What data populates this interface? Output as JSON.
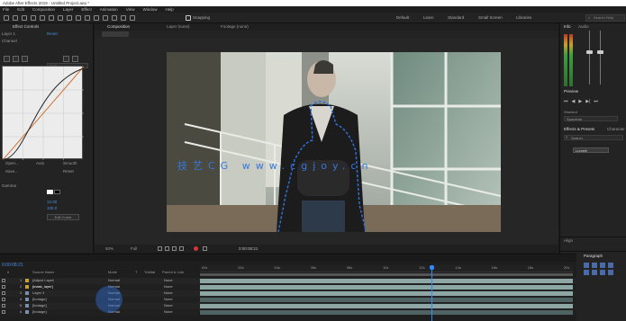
{
  "title_bar": {
    "text": "Adobe After Effects 2019 - Untitled Project.aep *"
  },
  "menu": [
    "File",
    "Edit",
    "Composition",
    "Layer",
    "Effect",
    "Animation",
    "View",
    "Window",
    "Help"
  ],
  "toolbar": {
    "snapping_label": "Snapping",
    "workspaces": [
      "Default",
      "Learn",
      "Standard",
      "Small Screen",
      "Libraries"
    ],
    "active_workspace": "",
    "search_placeholder": "Search Help"
  },
  "left_panel": {
    "tab_label": "Effect Controls",
    "layer_label": "Layer 1",
    "channel_label": "Channel",
    "channel_value": "RGB",
    "curve_buttons": [
      "Open...",
      "Auto",
      "Smooth",
      "Save...",
      "Reset"
    ],
    "gamma_label": "Gamma",
    "gamma_value": "",
    "values": [
      "12.00",
      "100.0"
    ],
    "edit_button": "Edit Curve"
  },
  "viewer": {
    "comp_tab": "Composition",
    "layer_tab": "Layer (none)",
    "footage_tab": "Footage (none)",
    "watermark": "技艺CG www.cgjoy.cn",
    "zoom": "50%",
    "quality": "Full",
    "timecode": "0:00:08:21"
  },
  "right_panel": {
    "info_tab": "Info",
    "audio_tab": "Audio",
    "preview_tab": "Preview",
    "shortcut_label": "Shortcut",
    "shortcut_value": "Spacebar",
    "effects_tab": "Effects & Presets",
    "chars_tab": "Character",
    "search_text": "Search",
    "library_item": "Lumetri",
    "bottom_tab": "Align",
    "paragraph_tab": "Paragraph"
  },
  "timeline": {
    "timecode": "0:00:08:21",
    "columns": [
      "#",
      "Source Name",
      "Mode",
      "T",
      "TrkMat",
      "Parent & Link"
    ],
    "ruler": [
      "00s",
      "02s",
      "04s",
      "06s",
      "08s",
      "10s",
      "12s",
      "14s",
      "16s",
      "18s",
      "20s"
    ],
    "playhead_fraction": 0.62,
    "layers": [
      {
        "num": "1",
        "name": "[Adjust Layer]",
        "mode": "Normal",
        "parent": "None"
      },
      {
        "num": "2",
        "name": "[mask_layer]",
        "mode": "Normal",
        "parent": "None"
      },
      {
        "num": "3",
        "name": "Layer 3",
        "mode": "Normal",
        "parent": "None"
      },
      {
        "num": "4",
        "name": "[footage]",
        "mode": "Normal",
        "parent": "None"
      },
      {
        "num": "5",
        "name": "[footage]",
        "mode": "Normal",
        "parent": "None"
      },
      {
        "num": "6",
        "name": "[footage]",
        "mode": "Normal",
        "parent": "None"
      }
    ]
  },
  "colors": {
    "accent": "#2f6fd6",
    "bar_light": "#8fa7a4",
    "bar_dark": "#4f6462",
    "bar_selected": "#8aa7a3"
  }
}
